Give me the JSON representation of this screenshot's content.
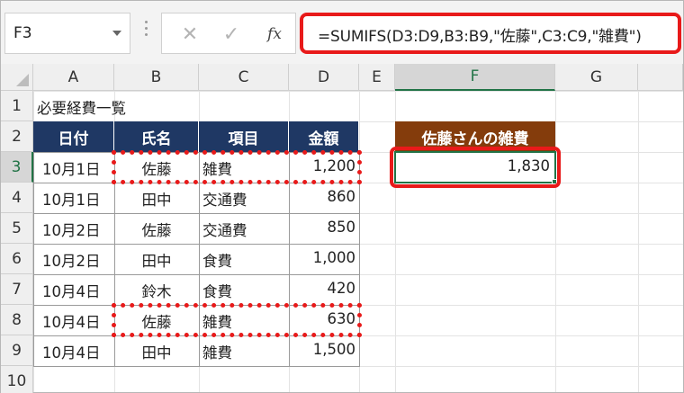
{
  "name_box": {
    "value": "F3"
  },
  "formula_bar": {
    "cancel_icon": "close-icon",
    "enter_icon": "check-icon",
    "fx_label": "fx",
    "formula": "=SUMIFS(D3:D9,B3:B9,\"佐藤\",C3:C9,\"雑費\")"
  },
  "columns": [
    "A",
    "B",
    "C",
    "D",
    "E",
    "F",
    "G"
  ],
  "rows": [
    "1",
    "2",
    "3",
    "4",
    "5",
    "6",
    "7",
    "8",
    "9",
    "10"
  ],
  "selected_cell": {
    "column": "F",
    "row": "3"
  },
  "sheet": {
    "title": "必要経費一覧",
    "table_headers": [
      "日付",
      "氏名",
      "項目",
      "金額"
    ],
    "table_rows": [
      [
        "10月1日",
        "佐藤",
        "雑費",
        "1,200"
      ],
      [
        "10月1日",
        "田中",
        "交通費",
        "860"
      ],
      [
        "10月2日",
        "佐藤",
        "交通費",
        "850"
      ],
      [
        "10月2日",
        "田中",
        "食費",
        "1,000"
      ],
      [
        "10月4日",
        "鈴木",
        "食費",
        "420"
      ],
      [
        "10月4日",
        "佐藤",
        "雑費",
        "630"
      ],
      [
        "10月4日",
        "田中",
        "雑費",
        "1,500"
      ]
    ],
    "result_header": "佐藤さんの雑費",
    "result_value": "1,830"
  },
  "colors": {
    "table_header_bg": "#1f3864",
    "result_header_bg": "#843c0c",
    "highlight_red": "#e81a1a",
    "selection_green": "#217346"
  }
}
